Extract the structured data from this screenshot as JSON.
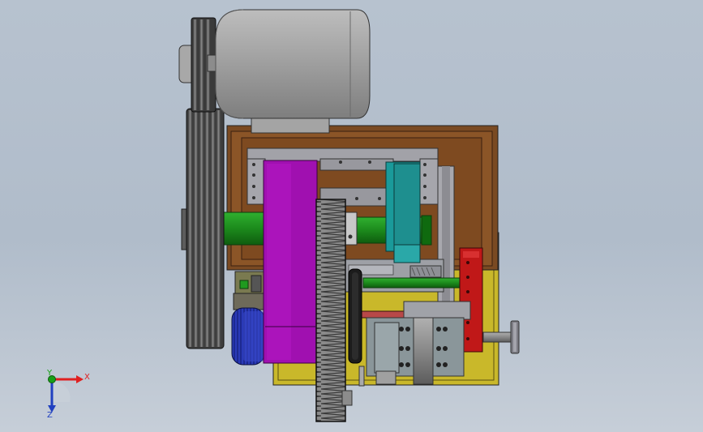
{
  "viewport": {
    "background_top": "#b7c2cf",
    "background_bottom": "#c6ced8"
  },
  "triad": {
    "x_label": "X",
    "y_label": "Y",
    "z_label": "Z",
    "x_color": "#e02020",
    "y_color": "#18a018",
    "z_color": "#2040c0"
  },
  "colors": {
    "motor": "#9a9a9a",
    "frame_wood": "#7a4a22",
    "magenta_housing": "#a010b0",
    "teal_block": "#1a9a9a",
    "green_shaft": "#1f9a1f",
    "red_block": "#c01818",
    "yellow_base": "#c9b82a",
    "blue_gear": "#2838b0"
  }
}
